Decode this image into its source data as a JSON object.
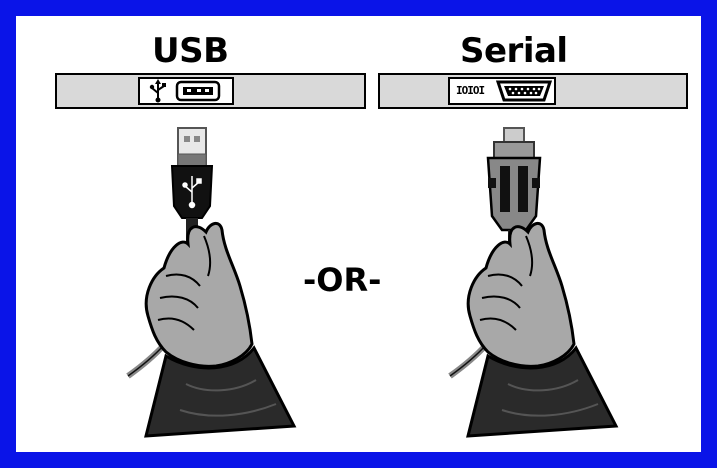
{
  "usb": {
    "title": "USB"
  },
  "serial": {
    "title": "Serial",
    "port_label": "IOIOI"
  },
  "separator": "-OR-",
  "colors": {
    "border": "#0a14e8",
    "panel": "#d9d9d9",
    "hand": "#a8a8a8",
    "sleeve": "#2a2a2a"
  },
  "icons": [
    "usb-symbol-icon",
    "usb-port-icon",
    "serial-port-icon",
    "usb-plug-icon",
    "serial-plug-icon",
    "hand-icon"
  ]
}
